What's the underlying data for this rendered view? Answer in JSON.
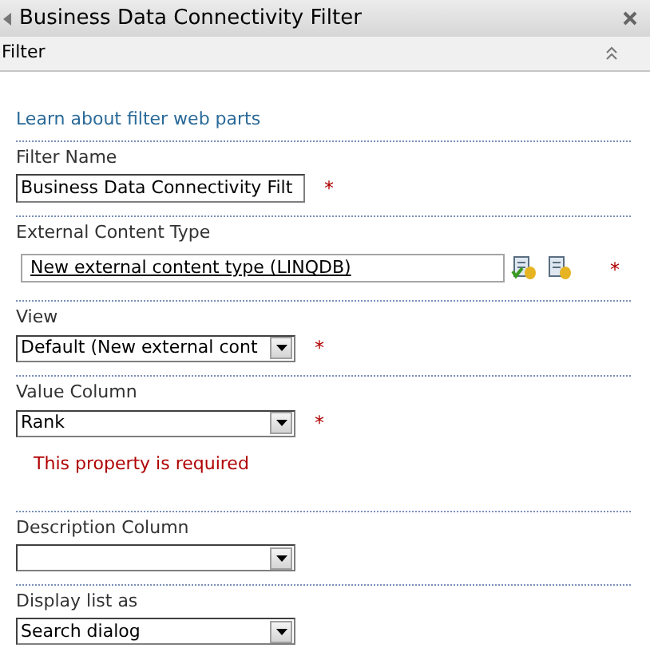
{
  "window": {
    "title": "Business Data Connectivity Filter"
  },
  "section": {
    "title": "Filter",
    "expanded": true
  },
  "help_link": "Learn about filter web parts",
  "fields": [
    {
      "kind": "text",
      "label": "Filter Name",
      "value": "Business Data Connectivity Filt",
      "required_mark": "*"
    },
    {
      "kind": "picker",
      "label": "External Content Type",
      "value": "New external content type (LINQDB)",
      "required_mark": "*"
    },
    {
      "kind": "select",
      "label": "View",
      "value": "Default (New external cont",
      "required_mark": "*"
    },
    {
      "kind": "select",
      "label": "Value Column",
      "value": "Rank",
      "required_mark": "*",
      "error": "This property is required"
    },
    {
      "kind": "select",
      "label": "Description Column"
    },
    {
      "kind": "select",
      "label": "Display list as",
      "value": "Search dialog"
    }
  ]
}
